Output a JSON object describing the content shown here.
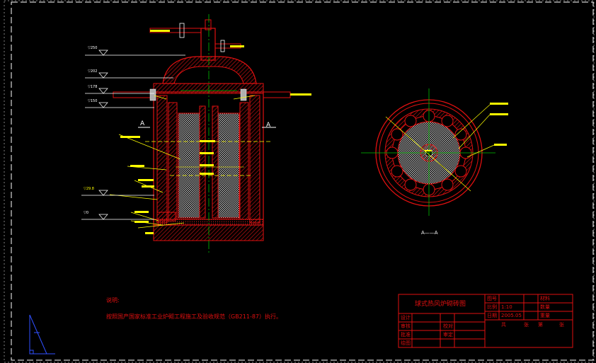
{
  "drawing": {
    "elevation_labels": [
      "▽250",
      "▽202",
      "▽178",
      "▽150",
      "▽29.8",
      "▽0"
    ],
    "section_markers": [
      "A",
      "A"
    ],
    "section_caption": "A——A"
  },
  "notes": {
    "heading": "说明:",
    "body": "按照国产国家标准工业炉砌工程施工及验收规范（GB211-87）执行。"
  },
  "title_block": {
    "title": "球式热风炉砌砖图",
    "labels": {
      "drawing_no": "图号",
      "scale": "比例",
      "date": "日期",
      "material": "材料",
      "quantity": "数量",
      "weight": "重量",
      "sheet_of": "共",
      "sheet": "第",
      "sheet_unit": "张",
      "designer": "设计",
      "checker": "审核",
      "approver": "批准",
      "proofread": "校对",
      "review": "审定",
      "draw": "绘图"
    },
    "values": {
      "scale": "1:10",
      "date": "2005.05"
    }
  },
  "colors": {
    "frame": "#ffffff",
    "structure": "#e01010",
    "annotation": "#ffff00",
    "centerline": "#00c000",
    "hatch": "#d01818"
  }
}
